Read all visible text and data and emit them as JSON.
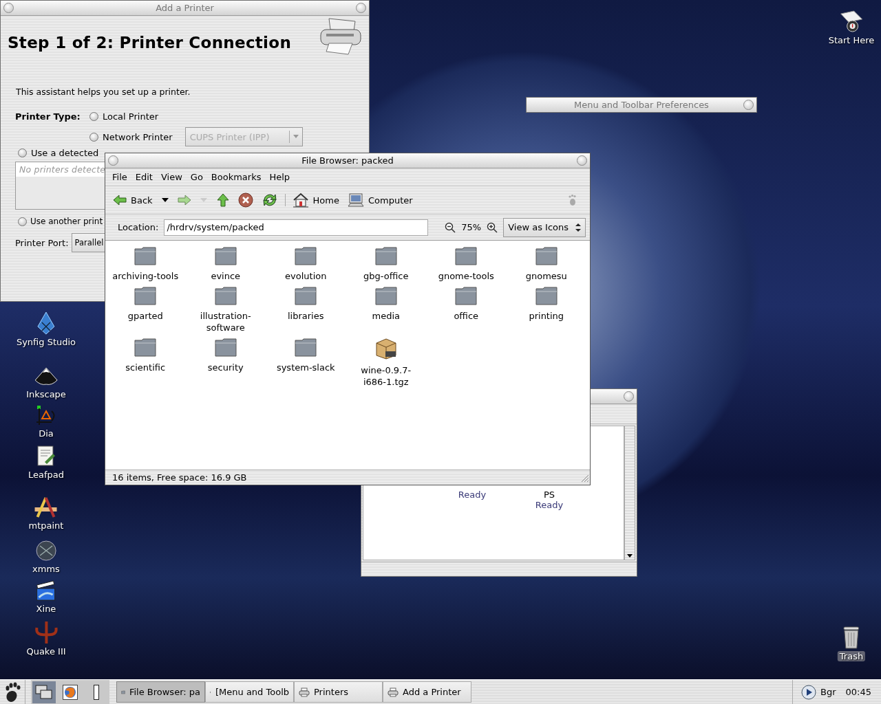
{
  "desktop_icons": [
    {
      "label": "Synfig Studio",
      "kind": "crystal"
    },
    {
      "label": "Inkscape",
      "kind": "mountain"
    },
    {
      "label": "Dia",
      "kind": "diagram"
    },
    {
      "label": "Leafpad",
      "kind": "notepad"
    },
    {
      "label": "mtpaint",
      "kind": "pencils"
    },
    {
      "label": "xmms",
      "kind": "disc"
    },
    {
      "label": "Xine",
      "kind": "clapper"
    },
    {
      "label": "Quake III",
      "kind": "emblem"
    },
    {
      "label": "Start Here",
      "kind": "start"
    },
    {
      "label": "Trash",
      "kind": "trash"
    }
  ],
  "add_printer_window": {
    "title": "Add a Printer",
    "focused": false,
    "heading": "Step 1 of 2: Printer Connection",
    "intro": "This assistant helps you set up a printer.",
    "printer_type_label": "Printer Type:",
    "printer_types": [
      {
        "label": "Local Printer",
        "selected": false
      },
      {
        "label": "Network Printer",
        "selected": false
      }
    ],
    "network_type": {
      "value": "CUPS Printer (IPP)",
      "disabled": true
    },
    "detected_option": {
      "label": "Use a detected",
      "selected": false
    },
    "detected_placeholder": "No printers detecte",
    "another_option": {
      "label": "Use another print",
      "selected": false
    },
    "port_label": "Printer Port:",
    "port_value": "Parallel"
  },
  "menu_prefs_window": {
    "title": "Menu and Toolbar Preferences",
    "focused": false
  },
  "printers_window": {
    "printers": [
      {
        "status": "Ready"
      },
      {
        "name": "PS",
        "status": "Ready"
      }
    ]
  },
  "file_browser": {
    "title": "File Browser: packed",
    "focused": true,
    "menu": [
      "File",
      "Edit",
      "View",
      "Go",
      "Bookmarks",
      "Help"
    ],
    "toolbar": [
      {
        "kind": "back",
        "label": "Back",
        "disabled": false
      },
      {
        "kind": "dropdown",
        "disabled": false
      },
      {
        "kind": "forward",
        "disabled": false
      },
      {
        "kind": "dropdown",
        "disabled": true
      },
      {
        "kind": "up",
        "disabled": false
      },
      {
        "kind": "stop",
        "disabled": false
      },
      {
        "kind": "reload",
        "disabled": false
      },
      {
        "kind": "separator"
      },
      {
        "kind": "home",
        "label": "Home",
        "disabled": false
      },
      {
        "kind": "computer",
        "label": "Computer",
        "disabled": false
      }
    ],
    "location_label": "Location:",
    "location": "/hrdrv/system/packed",
    "zoom": "75%",
    "view_mode": "View as Icons",
    "items": [
      {
        "name": "archiving-tools",
        "kind": "folder"
      },
      {
        "name": "evince",
        "kind": "folder"
      },
      {
        "name": "evolution",
        "kind": "folder"
      },
      {
        "name": "gbg-office",
        "kind": "folder"
      },
      {
        "name": "gnome-tools",
        "kind": "folder"
      },
      {
        "name": "gnomesu",
        "kind": "folder"
      },
      {
        "name": "gparted",
        "kind": "folder"
      },
      {
        "name": "illustration-software",
        "kind": "folder"
      },
      {
        "name": "libraries",
        "kind": "folder"
      },
      {
        "name": "media",
        "kind": "folder"
      },
      {
        "name": "office",
        "kind": "folder"
      },
      {
        "name": "printing",
        "kind": "folder"
      },
      {
        "name": "scientific",
        "kind": "folder"
      },
      {
        "name": "security",
        "kind": "folder"
      },
      {
        "name": "system-slack",
        "kind": "folder"
      },
      {
        "name": "wine-0.9.7-i686-1.tgz",
        "kind": "package"
      }
    ],
    "status": "16 items, Free space: 16.9 GB"
  },
  "taskbar": {
    "tasks": [
      {
        "label": "File Browser: pa",
        "kind": "folder",
        "selected": true
      },
      {
        "label": "[Menu and Toolb",
        "kind": "document",
        "selected": false
      },
      {
        "label": "Printers",
        "kind": "printer",
        "selected": false
      },
      {
        "label": "Add a Printer",
        "kind": "printer",
        "selected": false
      }
    ],
    "keyboard": "Bgr",
    "clock": "00:45"
  }
}
